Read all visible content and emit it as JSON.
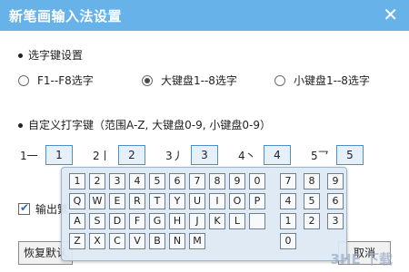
{
  "window": {
    "title": "新笔画输入法设置",
    "close_glyph": "✕"
  },
  "select_keys": {
    "heading": "选字键设置",
    "options": [
      "F1--F8选字",
      "大键盘1--8选字",
      "小键盘1--8选字"
    ],
    "selected_index": 1
  },
  "custom_keys": {
    "heading": "自定义打字键（范围A-Z, 大键盘0-9, 小键盘0-9）",
    "pairs": [
      {
        "label": "1一",
        "key": "1"
      },
      {
        "label": "2丨",
        "key": "2"
      },
      {
        "label": "3丿",
        "key": "3"
      },
      {
        "label": "4丶",
        "key": "4"
      },
      {
        "label": "5乛",
        "key": "5"
      }
    ]
  },
  "output_checkbox": {
    "label": "输出繁",
    "checked": true
  },
  "buttons": {
    "restore_default": "恢复默认",
    "cancel": "取消"
  },
  "keypad": {
    "main_rows": [
      [
        "1",
        "2",
        "3",
        "4",
        "5",
        "6",
        "7",
        "8",
        "9",
        "0"
      ],
      [
        "Q",
        "W",
        "E",
        "R",
        "T",
        "Y",
        "U",
        "I",
        "O",
        "P"
      ],
      [
        "A",
        "S",
        "D",
        "F",
        "G",
        "H",
        "J",
        "K",
        "L",
        ""
      ],
      [
        "Z",
        "X",
        "C",
        "V",
        "B",
        "N",
        "M"
      ]
    ],
    "numpad_rows": [
      [
        "7",
        "8",
        "9"
      ],
      [
        "4",
        "5",
        "6"
      ],
      [
        "1",
        "2",
        "3"
      ],
      [
        "0"
      ]
    ]
  },
  "watermark": "3HE 下载"
}
